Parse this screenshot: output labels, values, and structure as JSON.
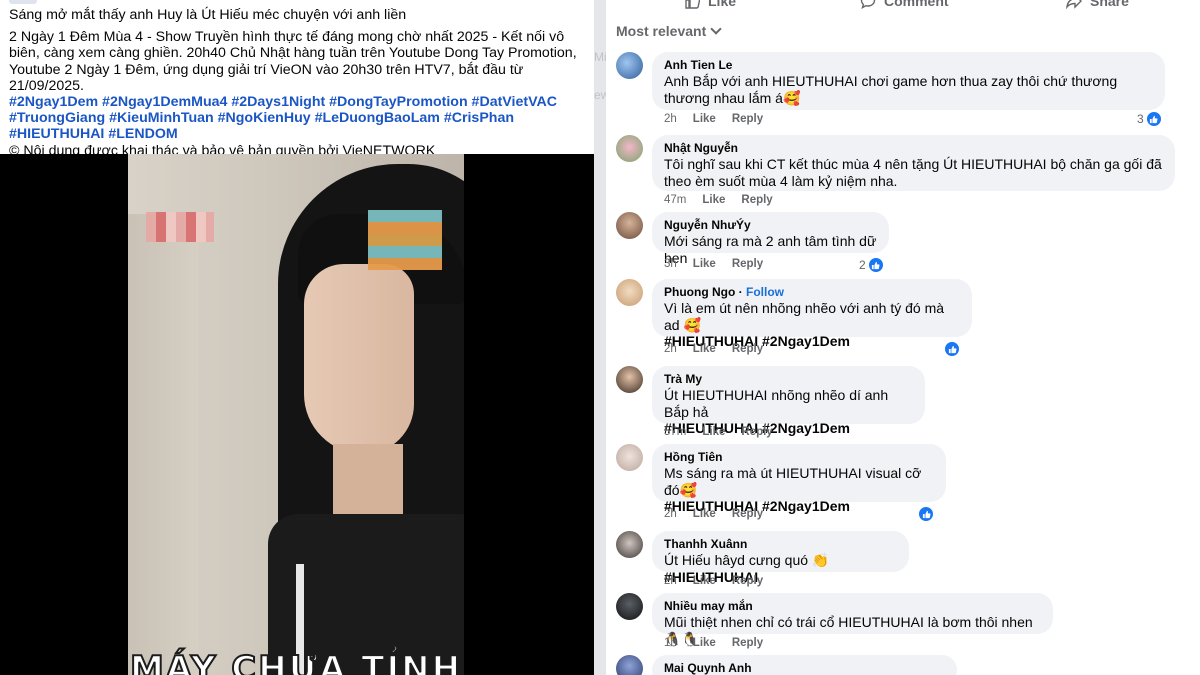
{
  "post": {
    "title": "Sáng mở mắt thấy anh Huy là Út Hiếu méc chuyện với anh liền",
    "body": "2 Ngày 1 Đêm Mùa 4 - Show Truyền hình thực tế đáng mong chờ nhất 2025 - Kết nối vô biên, càng xem càng ghiền. 20h40 Chủ Nhật hàng tuần trên Youtube Dong Tay Promotion, Youtube 2 Ngày 1 Đêm, ứng dụng giải trí VieON vào 20h30 trên HTV7, bắt đầu từ 21/09/2025.",
    "hashtags": "#2Ngay1Dem #2Ngay1DemMua4 #2Days1Night #DongTayPromotion #DatVietVAC #TruongGiang #KieuMinhTuan #NgoKienHuy #LeDuongBaoLam #CrisPhan #HIEUTHUHAI #LENDOM",
    "copyright": "© Nội dung được khai thác và bảo vệ bản quyền bởi VieNETWORK",
    "video_caption": "MÁY CHƯA TỈNH"
  },
  "gap_fragments": [
    "Mi",
    "ew"
  ],
  "actions": {
    "like": "Like",
    "comment": "Comment",
    "share": "Share"
  },
  "sort_label": "Most relevant",
  "comments": [
    {
      "name": "Anh Tien Le",
      "text": "Anh Bắp với anh HIEUTHUHAI chơi game hơn thua zay thôi chứ thương thương nhau lắm á🥰",
      "time": "2h",
      "like": "Like",
      "reply": "Reply",
      "reacts": "3"
    },
    {
      "name": "Nhật Nguyễn",
      "text": "Tôi nghĩ sau khi CT kết thúc mùa 4 nên tặng Út HIEUTHUHAI bộ chăn ga gối đã theo èm suốt mùa 4 làm kỷ niệm nha.",
      "time": "47m",
      "like": "Like",
      "reply": "Reply"
    },
    {
      "name": "Nguyễn NhưÝy",
      "text": "Mới sáng ra mà 2 anh tâm tình dữ hen",
      "time": "3h",
      "like": "Like",
      "reply": "Reply",
      "reacts": "2"
    },
    {
      "name": "Phuong Ngo",
      "follow": "Follow",
      "text": "Vì là em út nên nhõng nhẽo với anh tý đó mà ad 🥰",
      "tags": "#HIEUTHUHAI #2Ngay1Dem",
      "time": "2h",
      "like": "Like",
      "reply": "Reply"
    },
    {
      "name": "Trà My",
      "text": "Út HIEUTHUHAI nhõng nhẽo dí anh Bắp hả",
      "tags": "#HIEUTHUHAI #2Ngay1Dem",
      "time": "57m",
      "like": "Like",
      "reply": "Reply"
    },
    {
      "name": "Hồng Tiên",
      "text": "Ms sáng ra mà út HIEUTHUHAI visual cỡ đó🥰",
      "tags": "#HIEUTHUHAI #2Ngay1Dem",
      "time": "2h",
      "like": "Like",
      "reply": "Reply"
    },
    {
      "name": "Thanhh Xuânn",
      "text": "Út Hiếu hâyd cưng quó 👏",
      "tags": "#HIEUTHUHAI",
      "time": "2h",
      "like": "Like",
      "reply": "Reply"
    },
    {
      "name": "Nhiều may mắn",
      "text": "Mũi thiệt nhen chỉ có trái cổ HIEUTHUHAI là bơm thôi nhen 🐧🐧",
      "time": "1h",
      "like": "Like",
      "reply": "Reply"
    },
    {
      "name": "Mai Quynh Anh"
    }
  ],
  "colors": {
    "hashtag": "#1a56c4",
    "like_blue": "#1877f2",
    "bubble": "#f0f2f5",
    "meta": "#65676b"
  },
  "icons": [
    "thumbs-up-icon",
    "comment-icon",
    "share-icon",
    "chevron-down-icon",
    "like-reaction-icon"
  ]
}
